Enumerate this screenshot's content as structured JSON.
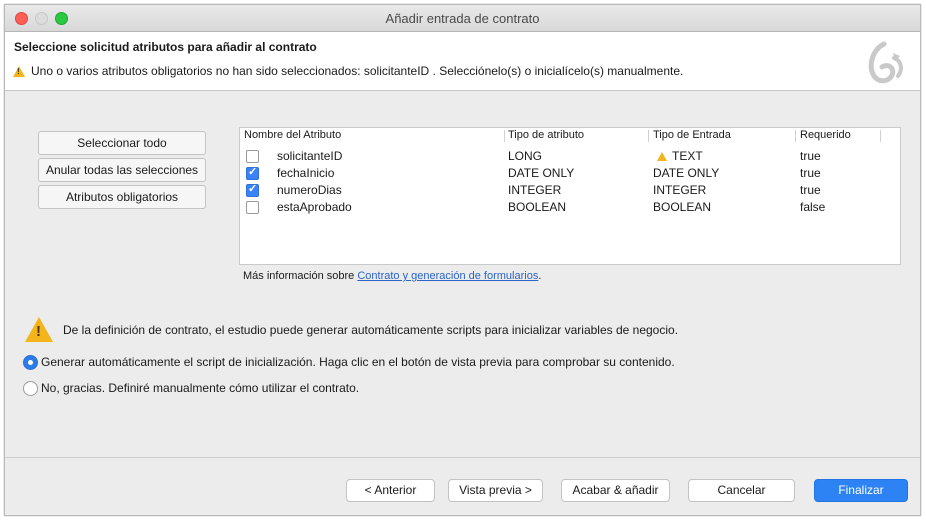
{
  "window": {
    "title": "Añadir entrada de contrato"
  },
  "header": {
    "heading": "Seleccione solicitud atributos para añadir al contrato",
    "warning": "Uno o varios atributos obligatorios no han sido seleccionados: solicitanteID . Selecciónelo(s) o inicialícelo(s) manualmente."
  },
  "side_buttons": {
    "select_all": "Seleccionar todo",
    "deselect_all": "Anular todas las selecciones",
    "required": "Atributos obligatorios"
  },
  "table": {
    "columns": [
      "Nombre del Atributo",
      "Tipo de atributo",
      "Tipo de Entrada",
      "Requerido"
    ],
    "rows": [
      {
        "checked": false,
        "name": "solicitanteID",
        "type": "LONG",
        "input": "TEXT",
        "input_warning": true,
        "required": "true"
      },
      {
        "checked": true,
        "name": "fechaInicio",
        "type": "DATE ONLY",
        "input": "DATE ONLY",
        "input_warning": false,
        "required": "true"
      },
      {
        "checked": true,
        "name": "numeroDias",
        "type": "INTEGER",
        "input": "INTEGER",
        "input_warning": false,
        "required": "true"
      },
      {
        "checked": false,
        "name": "estaAprobado",
        "type": "BOOLEAN",
        "input": "BOOLEAN",
        "input_warning": false,
        "required": "false"
      }
    ]
  },
  "info": {
    "prefix": "Más información sobre ",
    "link": "Contrato y generación de formularios",
    "suffix": "."
  },
  "script_section": {
    "message": "De la definición de contrato, el estudio puede generar automáticamente scripts para inicializar variables de negocio.",
    "options": [
      {
        "label": "Generar automáticamente el script de inicialización. Haga clic en el botón de vista previa para comprobar su contenido.",
        "selected": true
      },
      {
        "label": "No, gracias. Definiré manualmente cómo utilizar el contrato.",
        "selected": false
      }
    ]
  },
  "footer": {
    "back": "< Anterior",
    "preview": "Vista previa >",
    "finish_add": "Acabar & añadir",
    "cancel": "Cancelar",
    "finish": "Finalizar"
  },
  "colors": {
    "accent": "#2d83f4",
    "warning": "#f2b51c",
    "link": "#2a64c8"
  }
}
